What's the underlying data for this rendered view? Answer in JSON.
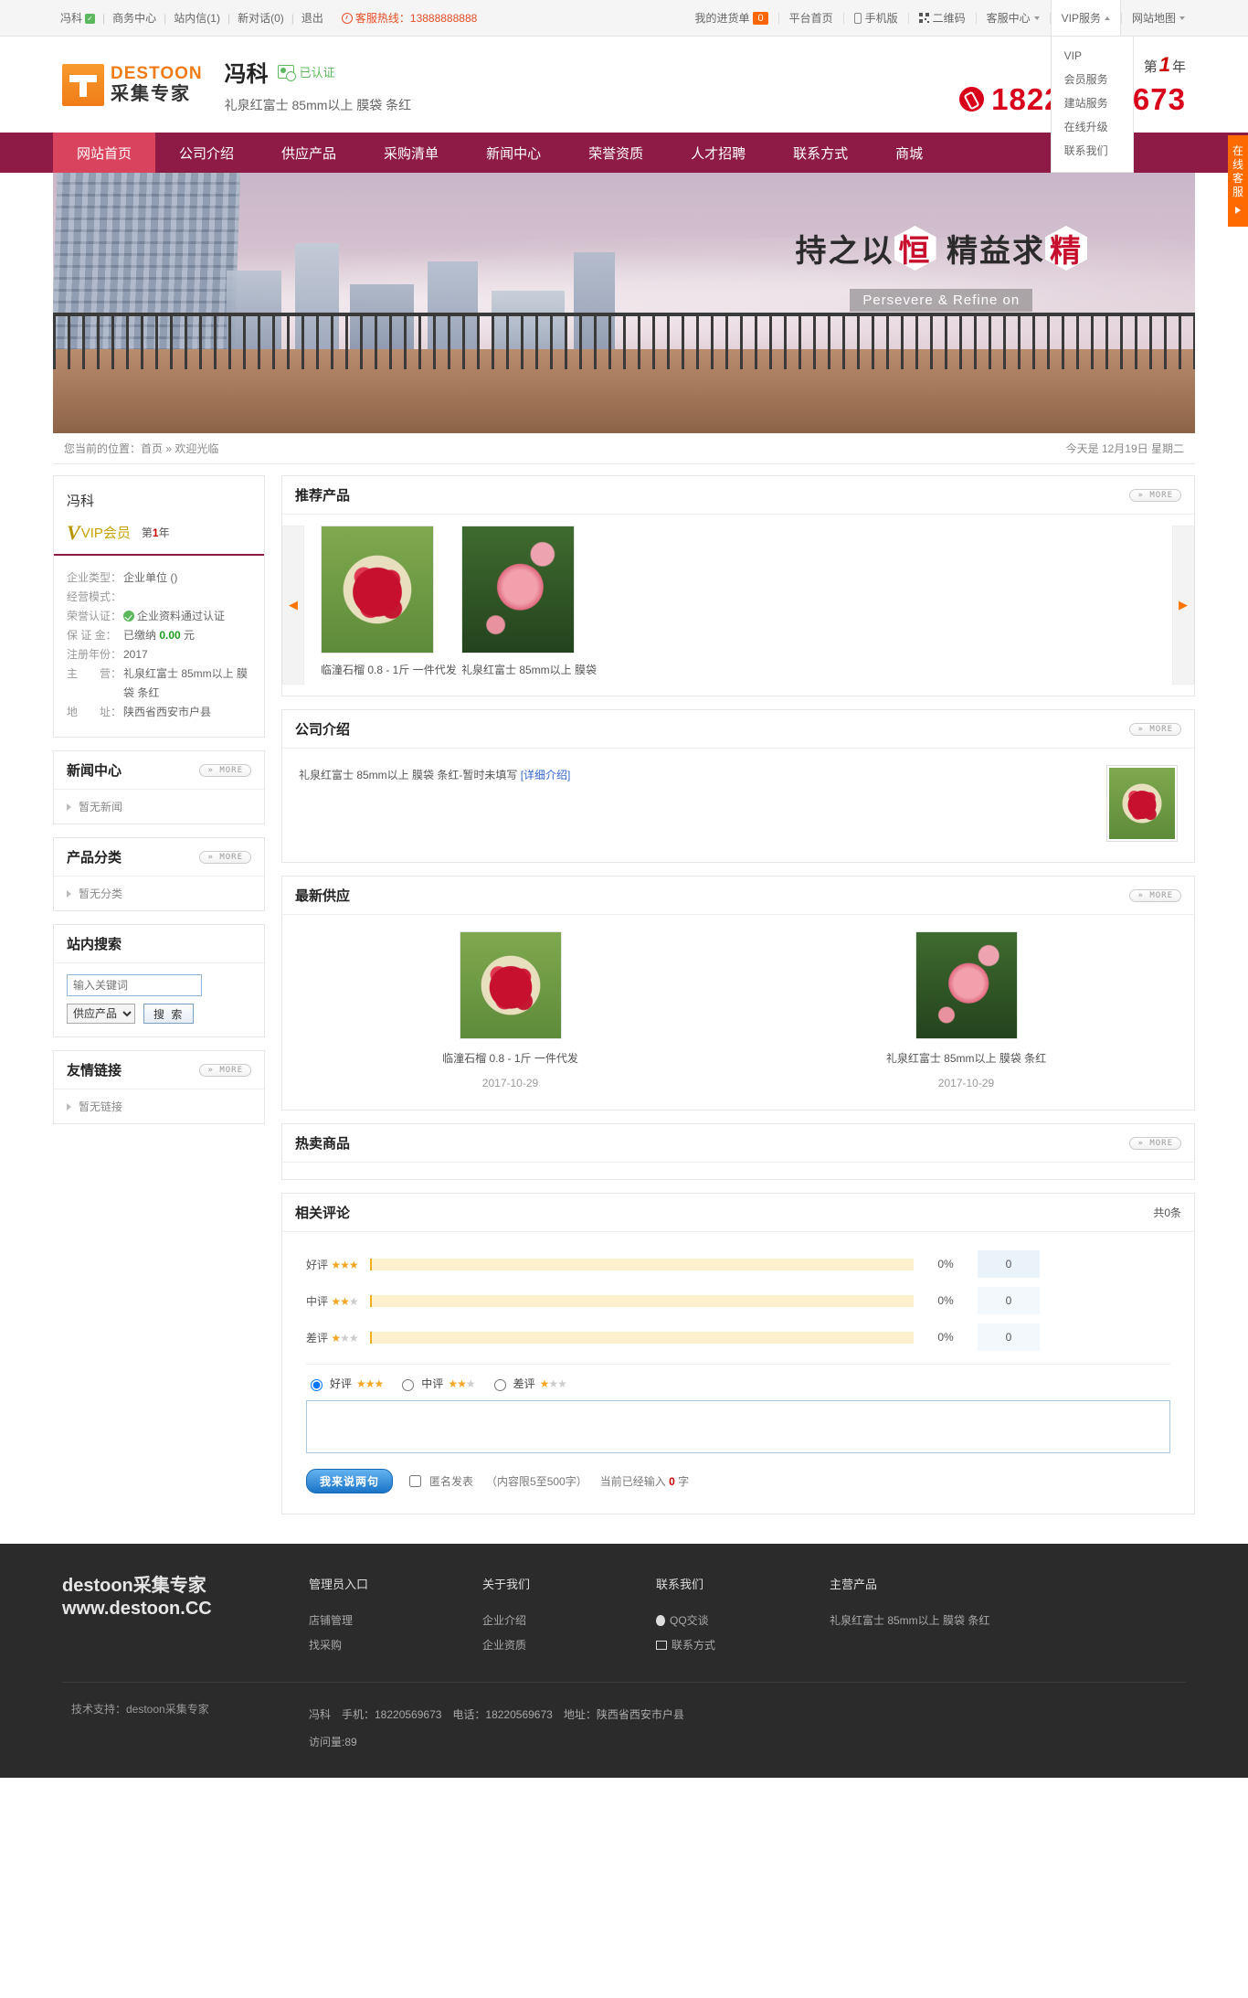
{
  "topbar": {
    "left": [
      {
        "label": "冯科",
        "badge": "✓"
      },
      {
        "label": "商务中心"
      },
      {
        "label": "站内信(1)"
      },
      {
        "label": "新对话(0)"
      },
      {
        "label": "退出"
      }
    ],
    "hotline_label": "客服热线：13888888888",
    "right": {
      "my_order": "我的进货单",
      "my_order_count": "0",
      "platform_home": "平台首页",
      "mobile": "手机版",
      "qrcode": "二维码",
      "service_center": "客服中心",
      "vip_service": "VIP服务",
      "sitemap": "网站地图"
    },
    "vip_dropdown": [
      "VIP",
      "会员服务",
      "建站服务",
      "在线升级",
      "联系我们"
    ]
  },
  "header": {
    "logo_line1": "DESTOON",
    "logo_line2": "采集专家",
    "company_name": "冯科",
    "cert_text": "已认证",
    "company_sub": "礼泉红富士 85mm以上 膜袋 条红",
    "year_prefix": "第",
    "year_num": "1",
    "year_suffix": "年",
    "phone": "18220569673"
  },
  "nav": [
    {
      "label": "网站首页",
      "active": true
    },
    {
      "label": "公司介绍",
      "active": false
    },
    {
      "label": "供应产品",
      "active": false
    },
    {
      "label": "采购清单",
      "active": false
    },
    {
      "label": "新闻中心",
      "active": false
    },
    {
      "label": "荣誉资质",
      "active": false
    },
    {
      "label": "人才招聘",
      "active": false
    },
    {
      "label": "联系方式",
      "active": false
    },
    {
      "label": "商城",
      "active": false
    }
  ],
  "banner": {
    "line1_a": "持之以",
    "line1_b": "恒",
    "line1_c": "精益求",
    "line1_d": "精",
    "line2": "Persevere & Refine on"
  },
  "posbar": {
    "position": "您当前的位置：首页 » 欢迎光临",
    "today": "今天是 12月19日 星期二"
  },
  "float_service": "在线客服",
  "sidebar": {
    "company_card": {
      "name": "冯科",
      "vip_label": "VIP会员",
      "vip_year_prefix": "第",
      "vip_year_num": "1",
      "vip_year_suffix": "年",
      "rows": [
        {
          "key": "企业类型：",
          "value": "企业单位 ()"
        },
        {
          "key": "经营模式：",
          "value": ""
        },
        {
          "key": "荣誉认证：",
          "value": "企业资料通过认证",
          "icon": "check-circle-icon"
        },
        {
          "key": "保 证 金：",
          "value_pre": "已缴纳 ",
          "value_strong": "0.00",
          "value_post": " 元"
        },
        {
          "key": "注册年份：",
          "value": "2017"
        },
        {
          "key": "主　　营：",
          "value": "礼泉红富士 85mm以上 膜袋 条红"
        },
        {
          "key": "地　　址：",
          "value": "陕西省西安市户县"
        }
      ]
    },
    "news": {
      "title": "新闻中心",
      "more": "» MORE",
      "empty": "暂无新闻"
    },
    "category": {
      "title": "产品分类",
      "more": "» MORE",
      "empty": "暂无分类"
    },
    "search": {
      "title": "站内搜索",
      "placeholder": "输入关键词",
      "value": "",
      "select_value": "供应产品",
      "select_options": [
        "供应产品",
        "采购清单",
        "新闻中心"
      ],
      "button": "搜 索"
    },
    "links": {
      "title": "友情链接",
      "more": "» MORE",
      "empty": "暂无链接"
    }
  },
  "main": {
    "recommended": {
      "title": "推荐产品",
      "more": "» MORE",
      "prev": "◀",
      "next": "▶",
      "items": [
        {
          "title": "临潼石榴 0.8 - 1斤 一件代发",
          "image": "pomegranate"
        },
        {
          "title": "礼泉红富士 85mm以上 膜袋",
          "image": "apple"
        }
      ]
    },
    "intro": {
      "title": "公司介绍",
      "more": "» MORE",
      "text": "礼泉红富士 85mm以上 膜袋 条红-暂时未填写",
      "link": "[详细介绍]",
      "thumb": "pomegranate"
    },
    "supply": {
      "title": "最新供应",
      "more": "» MORE",
      "items": [
        {
          "title": "临潼石榴 0.8 - 1斤 一件代发",
          "date": "2017-10-29",
          "image": "pomegranate"
        },
        {
          "title": "礼泉红富士 85mm以上 膜袋 条红",
          "date": "2017-10-29",
          "image": "apple"
        }
      ]
    },
    "hot": {
      "title": "热卖商品",
      "more": "» MORE"
    },
    "comments": {
      "title": "相关评论",
      "count_label": "共0条",
      "rows": [
        {
          "label": "好评",
          "stars": 3,
          "percent": "0%",
          "count": "0"
        },
        {
          "label": "中评",
          "stars": 2,
          "percent": "0%",
          "count": "0"
        },
        {
          "label": "差评",
          "stars": 1,
          "percent": "0%",
          "count": "0"
        }
      ],
      "radios": [
        {
          "label": "好评",
          "stars": 3,
          "checked": true
        },
        {
          "label": "中评",
          "stars": 2,
          "checked": false
        },
        {
          "label": "差评",
          "stars": 1,
          "checked": false
        }
      ],
      "textarea_value": "",
      "submit": "我来说两句",
      "anonymous": "匿名发表",
      "limit_note": "（内容限5至500字）",
      "typed_pre": "当前已经输入",
      "typed_num": "0",
      "typed_post": "字"
    }
  },
  "footer": {
    "brand_line1": "destoon采集专家",
    "brand_line2": "www.destoon.CC",
    "columns": [
      {
        "title": "管理员入口",
        "items": [
          "店铺管理",
          "找采购"
        ]
      },
      {
        "title": "关于我们",
        "items": [
          "企业介绍",
          "企业资质"
        ]
      },
      {
        "title": "联系我们",
        "items": [
          "QQ交谈",
          "联系方式"
        ]
      },
      {
        "title": "主营产品",
        "items": [
          "礼泉红富士 85mm以上 膜袋 条红"
        ]
      }
    ],
    "tech_support": "技术支持：destoon采集专家",
    "contact_line": "冯科　手机：18220569673　电话：18220569673　地址：陕西省西安市户县",
    "visits": "访问量:89"
  },
  "colors": {
    "nav_bg": "#8d1b45",
    "nav_active": "#d9435e",
    "accent_orange": "#ff6a00",
    "phone_red": "#d9001b",
    "vip_gold": "#c8a200"
  }
}
